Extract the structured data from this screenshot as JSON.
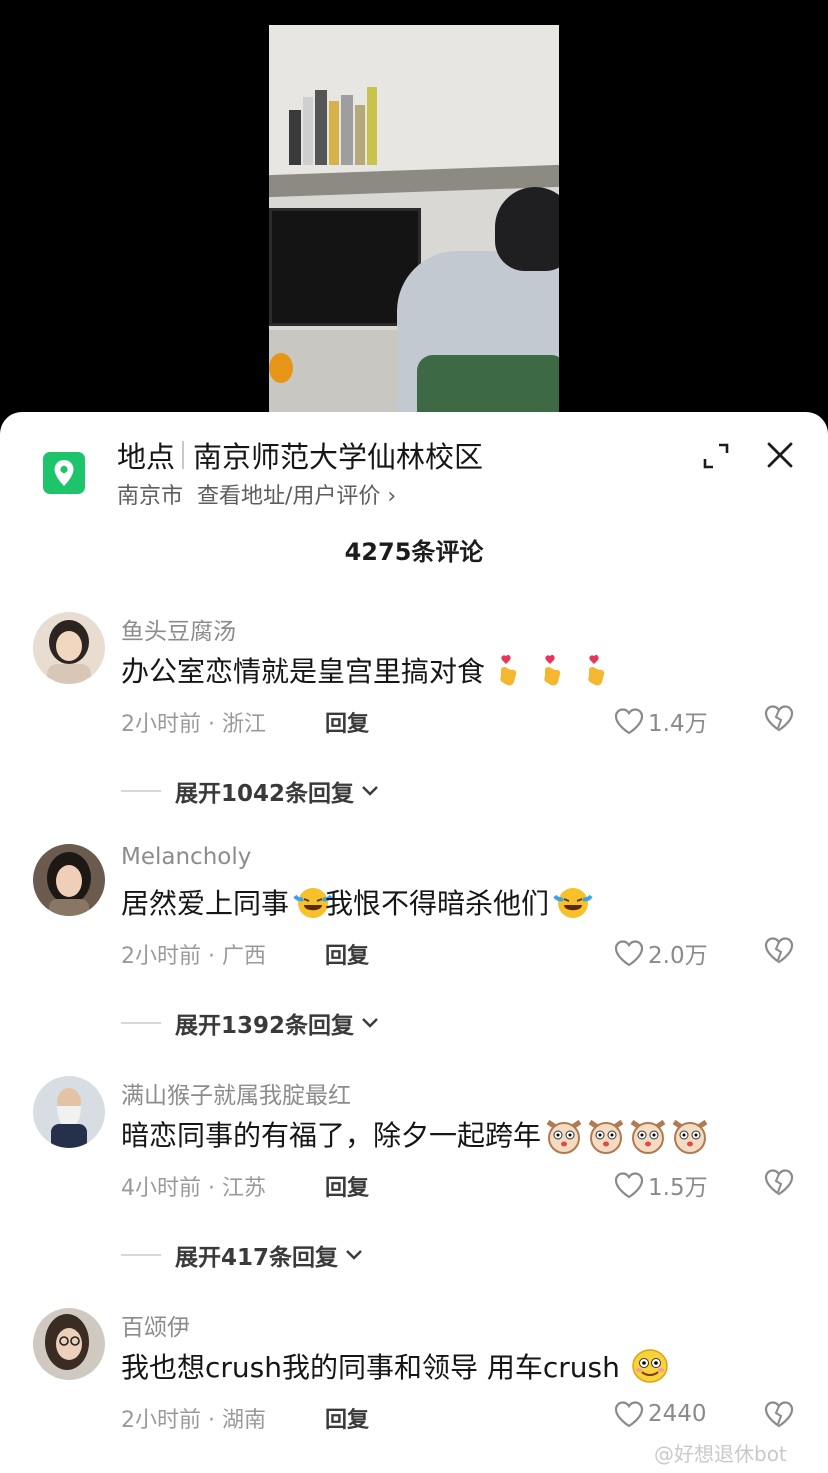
{
  "location": {
    "label": "地点",
    "name": "南京师范大学仙林校区",
    "city": "南京市",
    "link": "查看地址/用户评价 ›"
  },
  "comments_count": "4275条评论",
  "comments": [
    {
      "username": "鱼头豆腐汤",
      "text": "办公室恋情就是皇宫里搞对食",
      "emojis": [
        "finger-heart-emoji",
        "finger-heart-emoji",
        "finger-heart-emoji"
      ],
      "time_location": "2小时前 · 浙江",
      "reply_label": "回复",
      "likes": "1.4万",
      "expand": "展开1042条回复"
    },
    {
      "username": "Melancholy",
      "text_before": "居然爱上同事",
      "text_after": "我恨不得暗杀他们",
      "emojis": [
        "laugh-cry-emoji",
        "laugh-cry-emoji"
      ],
      "time_location": "2小时前 · 广西",
      "reply_label": "回复",
      "likes": "2.0万",
      "expand": "展开1392条回复"
    },
    {
      "username": "满山猴子就属我腚最红",
      "text": "暗恋同事的有福了，除夕一起跨年",
      "emojis": [
        "dog-face-emoji",
        "dog-face-emoji",
        "dog-face-emoji",
        "dog-face-emoji"
      ],
      "time_location": "4小时前 · 江苏",
      "reply_label": "回复",
      "likes": "1.5万",
      "expand": "展开417条回复"
    },
    {
      "username": "百颂伊",
      "text": "我也想crush我的同事和领导  用车crush",
      "emojis": [
        "smile-emoji"
      ],
      "time_location": "2小时前 · 湖南",
      "reply_label": "回复",
      "likes": "2440"
    }
  ],
  "watermark": "@好想退休bot",
  "colors": {
    "accent_green": "#1ec46a",
    "text_primary": "#161616",
    "text_secondary": "#8c8c8c"
  }
}
